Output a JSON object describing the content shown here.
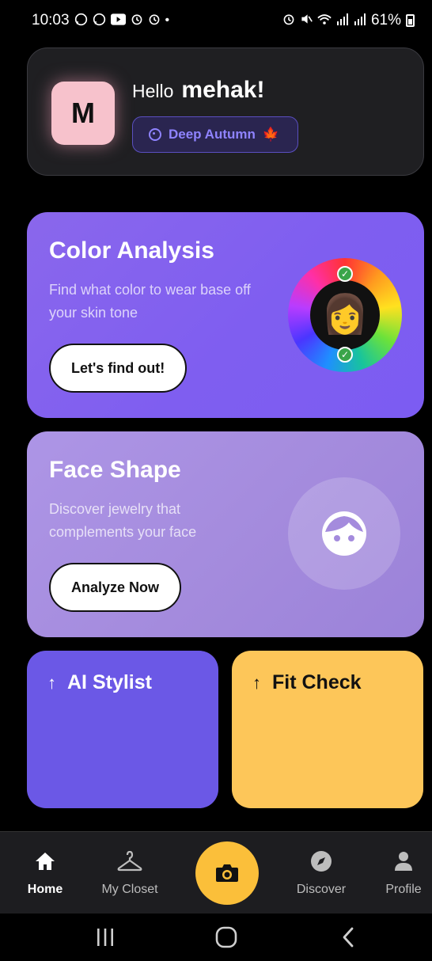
{
  "status_bar": {
    "time": "10:03",
    "battery": "61%",
    "left_icons": [
      "whatsapp-icon",
      "whatsapp-icon",
      "youtube-icon",
      "alarm-icon",
      "alarm-icon",
      "dot-icon"
    ],
    "right_icons": [
      "alarm-icon",
      "mute-icon",
      "wifi-icon",
      "signal-icon",
      "signal-icon",
      "battery-icon"
    ]
  },
  "profile": {
    "avatar_initial": "M",
    "greeting": "Hello",
    "name": "mehak!",
    "season_label": "Deep Autumn",
    "season_icon": "palette-icon",
    "season_emoji": "🍁"
  },
  "color_analysis": {
    "title": "Color Analysis",
    "description": "Find what color to wear base off your skin tone",
    "button": "Let's find out!",
    "emoji": "👩"
  },
  "face_shape": {
    "title": "Face Shape",
    "description": "Discover jewelry that complements your face",
    "button": "Analyze Now"
  },
  "quick_cards": {
    "stylist": "AI Stylist",
    "fit_check": "Fit Check"
  },
  "bottom_nav": {
    "home": "Home",
    "closet": "My Closet",
    "discover": "Discover",
    "profile": "Profile"
  },
  "colors": {
    "accent_purple": "#7f5ef0",
    "accent_lavender": "#a48bdd",
    "stylist_card": "#6b58e6",
    "fit_check_card": "#fdc659",
    "camera_fab": "#fbbf3a",
    "avatar_bg": "#f7c2cc"
  }
}
